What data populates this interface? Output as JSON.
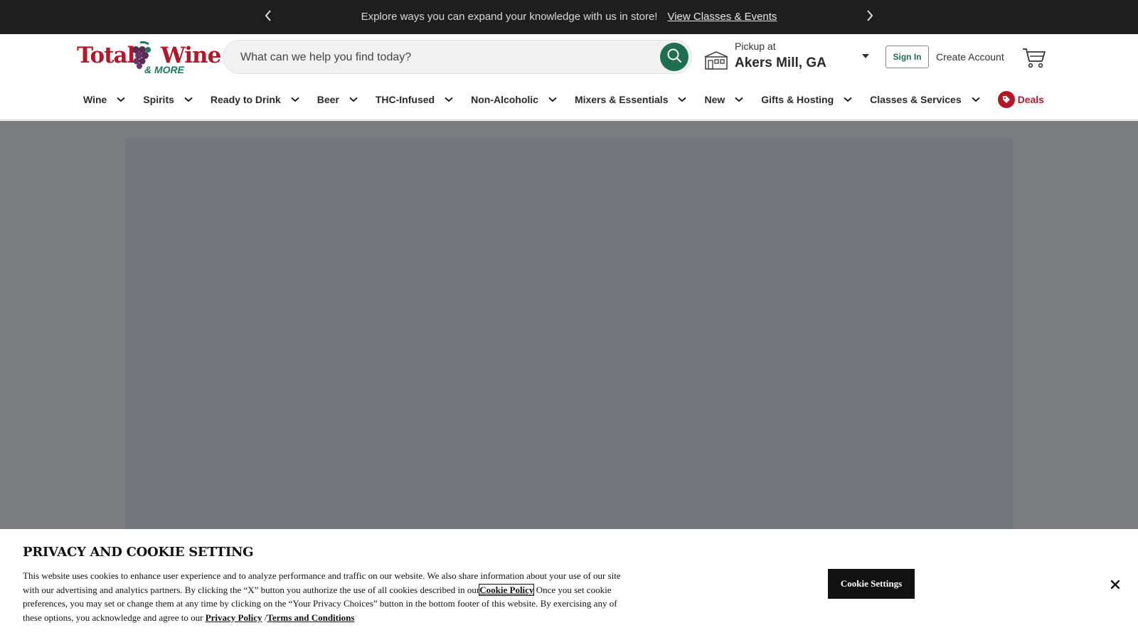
{
  "promo": {
    "message": "Explore ways you can expand your knowledge with us in store!",
    "link": "View Classes & Events"
  },
  "logo": {
    "word1": "Total",
    "word2": "Wine",
    "word3": "& MORE"
  },
  "search": {
    "placeholder": "What can we help you find today?"
  },
  "pickup": {
    "label": "Pickup at",
    "store": "Akers Mill, GA"
  },
  "account": {
    "sign_in": "Sign In",
    "create": "Create Account"
  },
  "nav": {
    "items": [
      {
        "label": "Wine"
      },
      {
        "label": "Spirits"
      },
      {
        "label": "Ready to Drink"
      },
      {
        "label": "Beer"
      },
      {
        "label": "THC-Infused"
      },
      {
        "label": "Non-Alcoholic"
      },
      {
        "label": "Mixers & Essentials"
      },
      {
        "label": "New"
      },
      {
        "label": "Gifts & Hosting"
      },
      {
        "label": "Classes & Services"
      }
    ],
    "deals": "Deals"
  },
  "cookie": {
    "title": "PRIVACY AND COOKIE SETTING",
    "text1": "This website uses cookies to enhance user experience and to analyze performance and traffic on our website. We also share information about your use of our site with our advertising and analytics partners. By clicking the “X” button you authorize the use of all cookies described in our",
    "cookie_policy": "Cookie Policy",
    "text2": " Once you set cookie preferences, you may set or change them at any time by clicking on the “Your Privacy Choices” button in the bottom footer of this website. By exercising any of these options, you acknowledge and agree to our ",
    "privacy_policy": "Privacy Policy",
    "separator": " /",
    "terms": "Terms and Conditions",
    "settings_button": "Cookie Settings"
  },
  "colors": {
    "brand_red": "#b3182a",
    "brand_green": "#1f6e50",
    "promo_bg": "#1e1e1e",
    "overlay": "#7b7d80"
  }
}
